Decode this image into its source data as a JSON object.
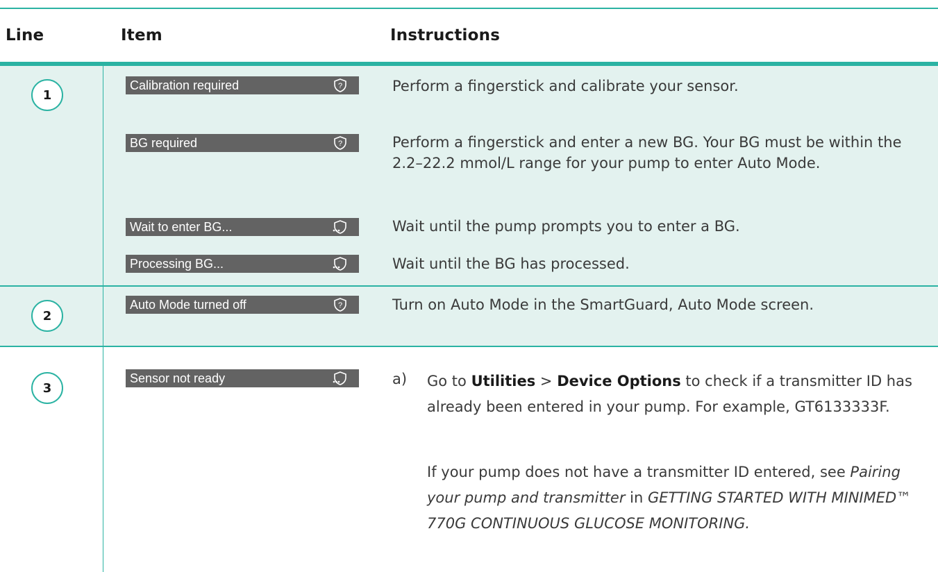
{
  "headers": {
    "line": "Line",
    "item": "Item",
    "instructions": "Instructions"
  },
  "rows": [
    {
      "line": "1",
      "alerts": [
        {
          "label": "Calibration required",
          "icon": "shield-question-icon",
          "instruction": "Perform a fingerstick and calibrate your sensor."
        },
        {
          "label": "BG required",
          "icon": "shield-question-icon",
          "instruction": "Perform a fingerstick and enter a new BG. Your BG must be within the 2.2–22.2 mmol/L range for your pump to enter Auto Mode."
        },
        {
          "label": "Wait to enter BG...",
          "icon": "shield-dots-icon",
          "instruction": "Wait until the pump prompts you to enter a BG."
        },
        {
          "label": "Processing BG...",
          "icon": "shield-dots-icon",
          "instruction": "Wait until the BG has processed."
        }
      ]
    },
    {
      "line": "2",
      "alerts": [
        {
          "label": "Auto Mode turned off",
          "icon": "shield-question-icon",
          "instruction": "Turn on Auto Mode in the SmartGuard, Auto Mode screen."
        }
      ]
    },
    {
      "line": "3",
      "alerts": [
        {
          "label": "Sensor not ready",
          "icon": "shield-dots-icon",
          "step_label": "a)",
          "step_a": {
            "pre": "Go to ",
            "bold1": "Utilities",
            "mid": " > ",
            "bold2": "Device Options",
            "post": " to check if a transmitter ID has already been entered in your pump. For example, GT6133333F."
          },
          "step_a2": {
            "pre": "If your pump does not have a transmitter ID entered, see ",
            "ital1": "Pairing your pump and transmitter",
            "mid": " in ",
            "ital2": "GETTING STARTED WITH MINIMED™ 770G CONTINUOUS GLUCOSE MONITORING."
          }
        }
      ]
    }
  ],
  "colors": {
    "accent": "#2bb3a3",
    "row_bg": "#e3f2ef",
    "pill_bg": "#636363"
  }
}
